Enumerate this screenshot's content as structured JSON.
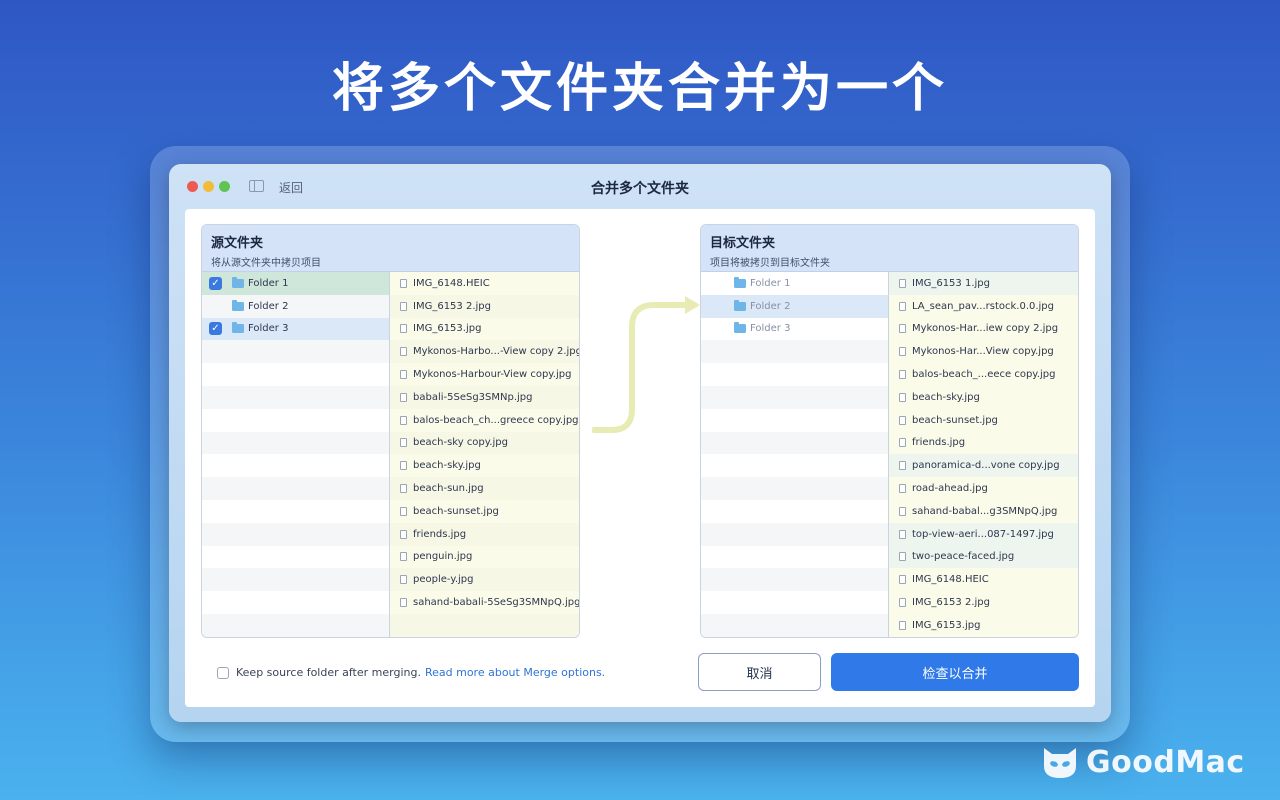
{
  "hero": {
    "title": "将多个文件夹合并为一个"
  },
  "window": {
    "title": "合并多个文件夹",
    "back_label": "返回"
  },
  "source_panel": {
    "title": "源文件夹",
    "subtitle": "将从源文件夹中拷贝项目",
    "folders": [
      {
        "name": "Folder 1",
        "checked": true
      },
      {
        "name": "Folder 2",
        "checked": false
      },
      {
        "name": "Folder 3",
        "checked": true
      }
    ],
    "files": [
      "IMG_6148.HEIC",
      "IMG_6153 2.jpg",
      "IMG_6153.jpg",
      "Mykonos-Harbo...-View copy 2.jpg",
      "Mykonos-Harbour-View copy.jpg",
      "babali-5SeSg3SMNp.jpg",
      "balos-beach_ch...greece copy.jpg",
      "beach-sky copy.jpg",
      "beach-sky.jpg",
      "beach-sun.jpg",
      "beach-sunset.jpg",
      "friends.jpg",
      "penguin.jpg",
      "people-y.jpg",
      "sahand-babali-5SeSg3SMNpQ.jpg"
    ]
  },
  "target_panel": {
    "title": "目标文件夹",
    "subtitle": "项目将被拷贝到目标文件夹",
    "folders": [
      {
        "name": "Folder 1"
      },
      {
        "name": "Folder 2"
      },
      {
        "name": "Folder 3"
      }
    ],
    "files": [
      "IMG_6153 1.jpg",
      "LA_sean_pav...rstock.0.0.jpg",
      "Mykonos-Har...iew copy 2.jpg",
      "Mykonos-Har...View copy.jpg",
      "balos-beach_...eece copy.jpg",
      "beach-sky.jpg",
      "beach-sunset.jpg",
      "friends.jpg",
      "panoramica-d...vone copy.jpg",
      "road-ahead.jpg",
      "sahand-babal...g3SMNpQ.jpg",
      "top-view-aeri...087-1497.jpg",
      "two-peace-faced.jpg",
      "IMG_6148.HEIC",
      "IMG_6153 2.jpg",
      "IMG_6153.jpg"
    ]
  },
  "footer": {
    "keep_label": "Keep source folder after merging.",
    "link_label": "Read more about Merge options.",
    "cancel_label": "取消",
    "primary_label": "检查以合并"
  },
  "brand": {
    "name": "GoodMac"
  },
  "colors": {
    "accent": "#2f7ae8",
    "arrow": "#e8ecb4",
    "folder": "#6fb5e8"
  }
}
